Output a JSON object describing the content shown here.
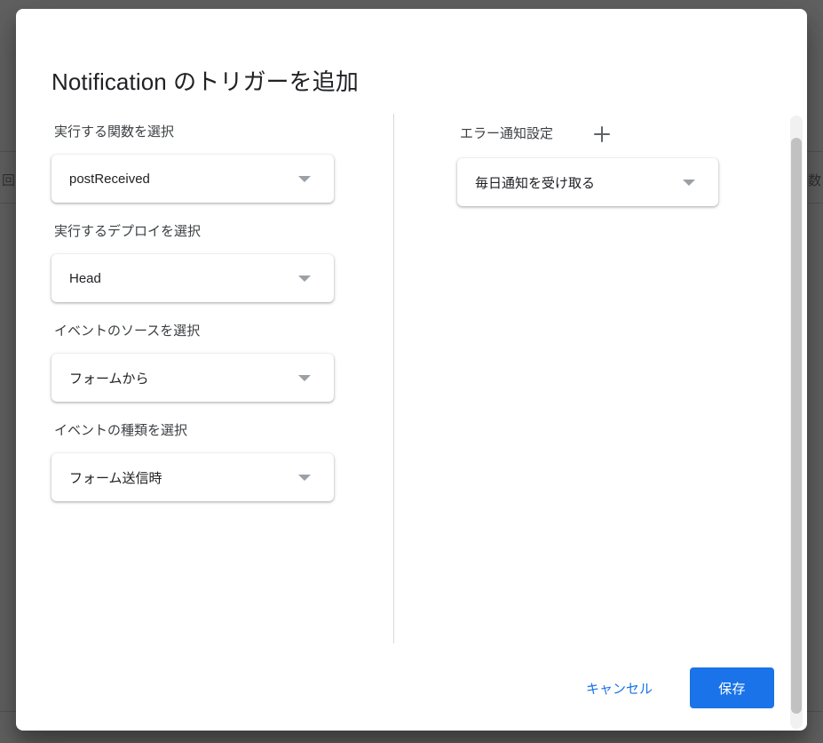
{
  "dialog": {
    "title_brand": "Notification",
    "title_rest": " のトリガーを追加"
  },
  "left_column": {
    "fields": [
      {
        "label": "実行する関数を選択",
        "value": "postReceived",
        "icon": "chevron-down-icon"
      },
      {
        "label": "実行するデプロイを選択",
        "value": "Head",
        "icon": "chevron-down-icon"
      },
      {
        "label": "イベントのソースを選択",
        "value": "フォームから",
        "icon": "chevron-down-icon"
      },
      {
        "label": "イベントの種類を選択",
        "value": "フォーム送信時",
        "icon": "chevron-down-icon"
      }
    ]
  },
  "right_column": {
    "label": "エラー通知設定",
    "add_icon": "plus-icon",
    "value": "毎日通知を受け取る",
    "icon": "chevron-down-icon"
  },
  "footer": {
    "cancel_label": "キャンセル",
    "save_label": "保存"
  },
  "background": {
    "left_glyph": "回",
    "right_glyph": "数"
  },
  "colors": {
    "accent": "#1a73e8",
    "dialog_bg": "#ffffff",
    "backdrop": "#606060",
    "label_text": "#3c4043",
    "value_text": "#202124",
    "divider": "#d6d8db",
    "arrow": "#9aa0a6",
    "scroll_thumb": "#c1c1c1"
  }
}
